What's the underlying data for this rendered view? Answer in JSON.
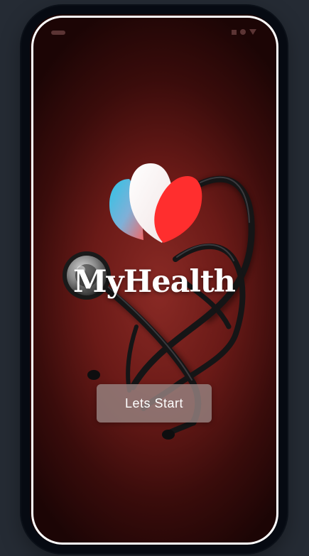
{
  "app": {
    "title": "MyHealth",
    "start_label": "Lets Start"
  },
  "icons": {
    "logo": "heart-petals-logo",
    "background": "stethoscope-illustration",
    "status_left": "notification-pill-icon",
    "status_right": [
      "square-icon",
      "dot-icon",
      "triangle-icon"
    ]
  },
  "colors": {
    "page_background": "#252b34",
    "device_frame": "#060a12",
    "screen_background": "#6a1a17",
    "logo_blue": "#2ec4e6",
    "logo_red": "#ff2a2a",
    "logo_white": "#ffffff",
    "button_background": "#968280",
    "button_text": "#ffffff"
  }
}
